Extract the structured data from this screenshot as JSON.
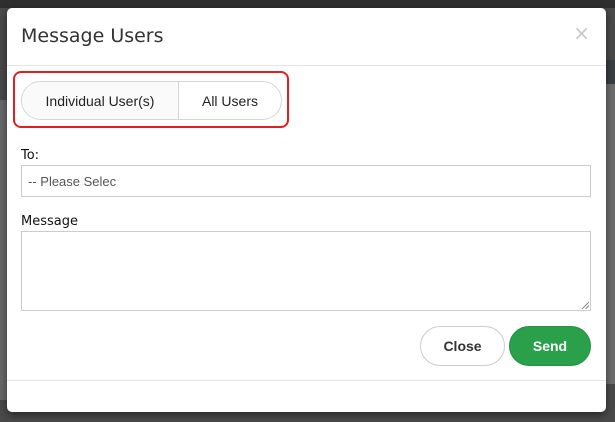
{
  "modal": {
    "title": "Message Users",
    "close_glyph": "×"
  },
  "recipient_toggle": {
    "options": [
      {
        "label": "Individual User(s)",
        "selected": true
      },
      {
        "label": "All Users",
        "selected": false
      }
    ]
  },
  "form": {
    "to_label": "To:",
    "to_placeholder": "-- Please Selec",
    "message_label": "Message",
    "message_value": ""
  },
  "footer": {
    "close_label": "Close",
    "send_label": "Send"
  },
  "colors": {
    "send_button": "#2aa04a",
    "highlight_border": "#e02020"
  }
}
